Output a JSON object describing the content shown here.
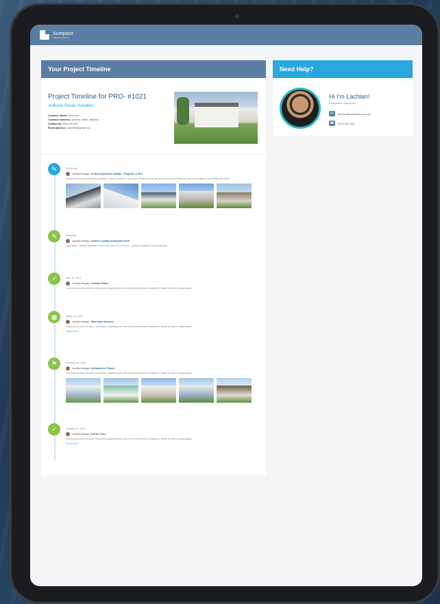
{
  "brand": {
    "name": "Surepaint",
    "tagline": "Painting Solutions"
  },
  "timeline_header": "Your Project Timeline",
  "help_header": "Need Help?",
  "project": {
    "title": "Project Timeline for  PRO- #1021",
    "address": "Anthony Street, Hamilton",
    "fields": [
      {
        "label": "Customer Name:",
        "value": "Jane Doe"
      },
      {
        "label": "Customer Address:",
        "value": "Anthony Street, Hamilton"
      },
      {
        "label": "Contact No:",
        "value": "0400 000 000"
      },
      {
        "label": "Email Address:",
        "value": "customer@gmail.com"
      }
    ]
  },
  "events": [
    {
      "date": "18 hrs ago",
      "author": "Lachlan Morgan",
      "title": "Project Inspection Update - Progress @ 80%",
      "desc": "Quality assessment meeting completed; surfaces scanned. Touch ups required on the fascia above the main balcony. Some downpipes to be painted this week.",
      "link": "",
      "icon": "brush-icon"
    },
    {
      "date": "Yesterday",
      "author": "Lachlan Morgan",
      "title": "Added a Quality Inspection Form",
      "desc": "Data sheet - Quality Inspection Form  Click here  |  PDF Version - Quality Inspection Form  Click here",
      "link": "",
      "icon": "brush-icon"
    },
    {
      "date": "April 10, 2024",
      "author": "Lachlan Morgan",
      "title": "Outside Glides",
      "desc": "Lorem ipsum dolor sit amet, consectetur adipiscing elit, sed do eiusmod tempor incididunt ut labore et dolore magna aliqua.",
      "link": "",
      "icon": "check-icon"
    },
    {
      "date": "March 10, 2024",
      "author": "Lachlan Morgan",
      "title": "Start Date Selected",
      "desc": "Lorem ipsum dolor sit amet, consectetur adipiscing elit, sed do eiusmod tempor incididunt ut labore et dolore magna aliqua.",
      "link": "Read more +",
      "icon": "calendar-icon"
    },
    {
      "date": "February 15, 2024",
      "author": "Lachlan Morgan",
      "title": "Uploaded an Project",
      "desc": "Lorem ipsum dolor sit amet, consectetur adipiscing elit, sed do eiusmod tempor incididunt ut labore et dolore magna aliqua.",
      "link": "",
      "icon": "pin-icon"
    },
    {
      "date": "January 20, 2024",
      "author": "Lachlan Morgan",
      "title": "Got for Time",
      "desc": "Lorem ipsum dolor sit amet, consectetur adipiscing elit, sed do eiusmod tempor incididunt ut labore et dolore magna aliqua.",
      "link": "Read more",
      "icon": "check-icon"
    }
  ],
  "help": {
    "name": "Hi I'm Lachlan!",
    "role": "Surepaints Supervisor",
    "email": "lachlan@surepaint.com.au",
    "phone": "0414 324 042"
  }
}
